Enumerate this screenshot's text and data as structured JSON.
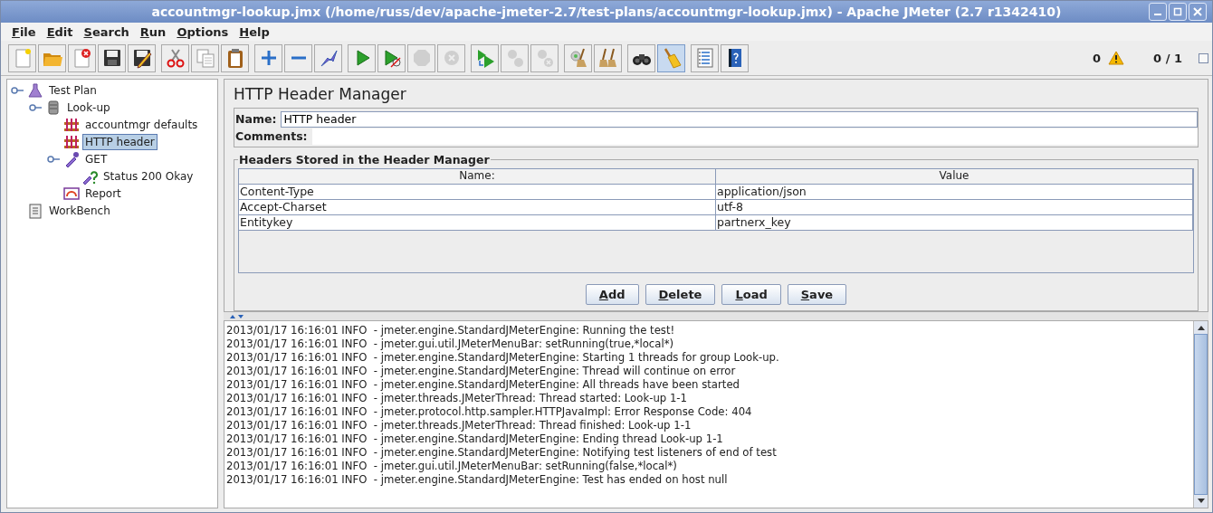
{
  "window": {
    "title": "accountmgr-lookup.jmx (/home/russ/dev/apache-jmeter-2.7/test-plans/accountmgr-lookup.jmx) - Apache JMeter (2.7 r1342410)"
  },
  "menu": [
    "File",
    "Edit",
    "Search",
    "Run",
    "Options",
    "Help"
  ],
  "toolbar": [
    [
      {
        "kind": "new",
        "disabled": false,
        "pressed": false
      },
      {
        "kind": "open",
        "disabled": false,
        "pressed": false
      },
      {
        "kind": "close",
        "disabled": false,
        "pressed": false
      },
      {
        "kind": "save",
        "disabled": false,
        "pressed": false
      },
      {
        "kind": "save-edit",
        "disabled": false,
        "pressed": false
      }
    ],
    [
      {
        "kind": "cut",
        "disabled": false,
        "pressed": false
      },
      {
        "kind": "copy",
        "disabled": false,
        "pressed": false
      },
      {
        "kind": "paste",
        "disabled": false,
        "pressed": false
      }
    ],
    [
      {
        "kind": "expand",
        "disabled": false,
        "pressed": false
      },
      {
        "kind": "collapse",
        "disabled": false,
        "pressed": false
      },
      {
        "kind": "toggle",
        "disabled": false,
        "pressed": false
      }
    ],
    [
      {
        "kind": "start",
        "disabled": false,
        "pressed": false
      },
      {
        "kind": "start-no-pause",
        "disabled": false,
        "pressed": false
      },
      {
        "kind": "stop",
        "disabled": true,
        "pressed": false
      },
      {
        "kind": "shutdown",
        "disabled": true,
        "pressed": false
      }
    ],
    [
      {
        "kind": "remote-start",
        "disabled": false,
        "pressed": false
      },
      {
        "kind": "remote-stop",
        "disabled": true,
        "pressed": false
      },
      {
        "kind": "remote-shutdown",
        "disabled": true,
        "pressed": false
      }
    ],
    [
      {
        "kind": "clear",
        "disabled": false,
        "pressed": false
      },
      {
        "kind": "clear-all",
        "disabled": false,
        "pressed": false
      }
    ],
    [
      {
        "kind": "search",
        "disabled": false,
        "pressed": false
      },
      {
        "kind": "reset-search",
        "disabled": false,
        "pressed": true
      }
    ],
    [
      {
        "kind": "function-helper",
        "disabled": false,
        "pressed": false
      },
      {
        "kind": "help",
        "disabled": false,
        "pressed": false
      }
    ]
  ],
  "status": {
    "error_count": "0",
    "threads": "0 / 1"
  },
  "tree": [
    {
      "label": "Test Plan",
      "kind": "test-plan",
      "selected": false,
      "expanded": true,
      "children": [
        {
          "label": "Look-up",
          "kind": "thread-group",
          "selected": false,
          "expanded": true,
          "children": [
            {
              "label": "accountmgr defaults",
              "kind": "config",
              "selected": false
            },
            {
              "label": "HTTP header",
              "kind": "config",
              "selected": true
            },
            {
              "label": "GET",
              "kind": "sampler",
              "selected": false,
              "expanded": true,
              "children": [
                {
                  "label": "Status 200 Okay",
                  "kind": "assertion",
                  "selected": false
                }
              ]
            },
            {
              "label": "Report",
              "kind": "listener",
              "selected": false
            }
          ]
        }
      ]
    },
    {
      "label": "WorkBench",
      "kind": "workbench",
      "selected": false
    }
  ],
  "panel": {
    "title": "HTTP Header Manager",
    "name_label": "Name:",
    "name_value": "HTTP header",
    "comments_label": "Comments:",
    "group_title": "Headers Stored in the Header Manager",
    "columns": [
      "Name:",
      "Value"
    ],
    "rows": [
      [
        "Content-Type",
        "application/json"
      ],
      [
        "Accept-Charset",
        "utf-8"
      ],
      [
        "Entitykey",
        "partnerx_key"
      ]
    ],
    "buttons": [
      "Add",
      "Delete",
      "Load",
      "Save"
    ]
  },
  "log": [
    "2013/01/17 16:16:01 INFO  - jmeter.engine.StandardJMeterEngine: Running the test!",
    "2013/01/17 16:16:01 INFO  - jmeter.gui.util.JMeterMenuBar: setRunning(true,*local*)",
    "2013/01/17 16:16:01 INFO  - jmeter.engine.StandardJMeterEngine: Starting 1 threads for group Look-up.",
    "2013/01/17 16:16:01 INFO  - jmeter.engine.StandardJMeterEngine: Thread will continue on error",
    "2013/01/17 16:16:01 INFO  - jmeter.engine.StandardJMeterEngine: All threads have been started",
    "2013/01/17 16:16:01 INFO  - jmeter.threads.JMeterThread: Thread started: Look-up 1-1",
    "2013/01/17 16:16:01 INFO  - jmeter.protocol.http.sampler.HTTPJavaImpl: Error Response Code: 404",
    "2013/01/17 16:16:01 INFO  - jmeter.threads.JMeterThread: Thread finished: Look-up 1-1",
    "2013/01/17 16:16:01 INFO  - jmeter.engine.StandardJMeterEngine: Ending thread Look-up 1-1",
    "2013/01/17 16:16:01 INFO  - jmeter.engine.StandardJMeterEngine: Notifying test listeners of end of test",
    "2013/01/17 16:16:01 INFO  - jmeter.gui.util.JMeterMenuBar: setRunning(false,*local*)",
    "2013/01/17 16:16:01 INFO  - jmeter.engine.StandardJMeterEngine: Test has ended on host null"
  ]
}
